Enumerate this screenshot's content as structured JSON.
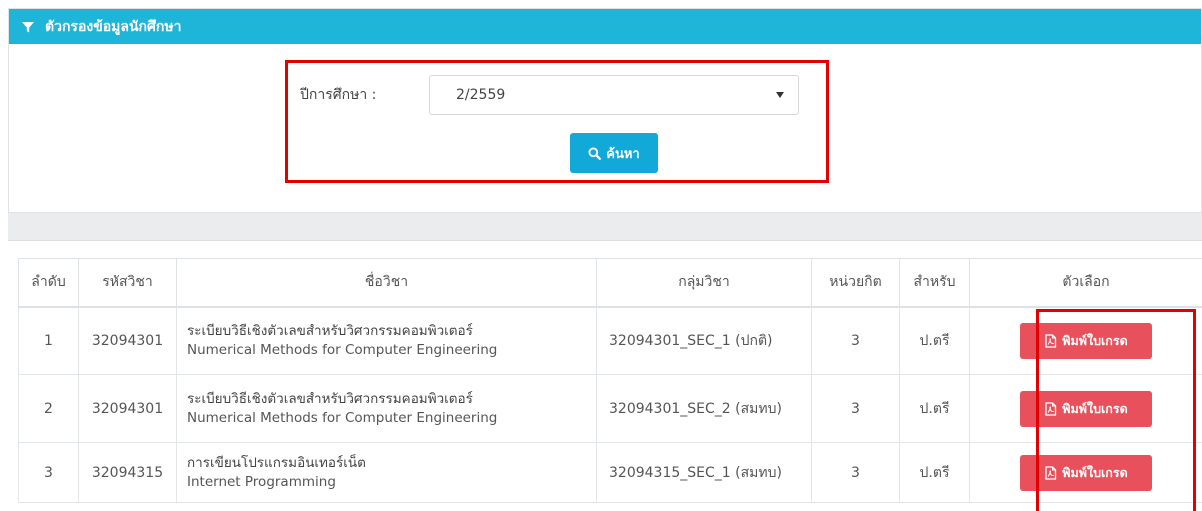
{
  "filter_panel": {
    "title": "ตัวกรองข้อมูลนักศึกษา",
    "year_label": "ปีการศึกษา :",
    "year_value": "2/2559",
    "search_label": "ค้นหา"
  },
  "table": {
    "headers": [
      "ลำดับ",
      "รหัสวิชา",
      "ชื่อวิชา",
      "กลุ่มวิชา",
      "หน่วยกิต",
      "สำหรับ",
      "ตัวเลือก"
    ],
    "rows": [
      {
        "no": "1",
        "code": "32094301",
        "name_th": "ระเบียบวิธีเชิงตัวเลขสำหรับวิศวกรรมคอมพิวเตอร์",
        "name_en": "Numerical Methods for Computer Engineering",
        "group": "32094301_SEC_1 (ปกติ)",
        "credits": "3",
        "for": "ป.ตรี",
        "action": "พิมพ์ใบเกรด"
      },
      {
        "no": "2",
        "code": "32094301",
        "name_th": "ระเบียบวิธีเชิงตัวเลขสำหรับวิศวกรรมคอมพิวเตอร์",
        "name_en": "Numerical Methods for Computer Engineering",
        "group": "32094301_SEC_2 (สมทบ)",
        "credits": "3",
        "for": "ป.ตรี",
        "action": "พิมพ์ใบเกรด"
      },
      {
        "no": "3",
        "code": "32094315",
        "name_th": "การเขียนโปรแกรมอินเทอร์เน็ต",
        "name_en": "Internet Programming",
        "group": "32094315_SEC_1 (สมทบ)",
        "credits": "3",
        "for": "ป.ตรี",
        "action": "พิมพ์ใบเกรด"
      }
    ]
  },
  "colors": {
    "header_bar": "#1fb5d8",
    "search_button": "#12a8d8",
    "print_button": "#e8505b",
    "highlight": "#e20000"
  },
  "icons": [
    "filter-icon",
    "search-icon",
    "pdf-icon"
  ]
}
